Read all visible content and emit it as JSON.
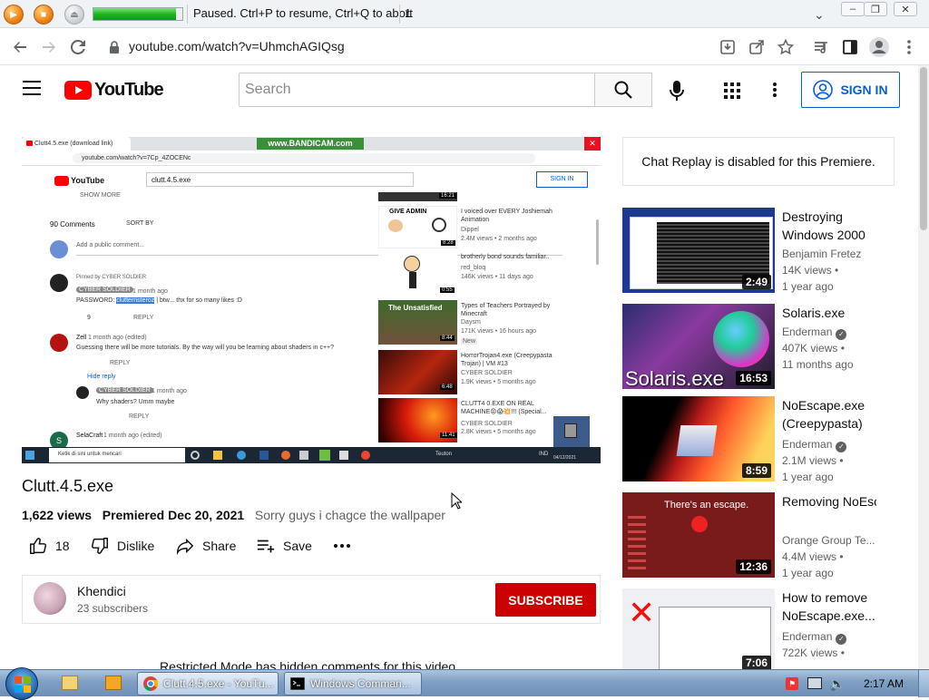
{
  "recorder": {
    "message": "Paused. Ctrl+P to resume, Ctrl+Q to abort",
    "count": "1",
    "progress": 0.93
  },
  "browser": {
    "url": "youtube.com/watch?v=UhmchAGIQsg"
  },
  "youtube": {
    "logo_text": "YouTube",
    "search_placeholder": "Search",
    "signin_label": "SIGN IN"
  },
  "video_frame": {
    "recording_watermark": "www.BANDICAM.com",
    "tab_title": "Clutt4.5.exe (download link)",
    "url": "youtube.com/watch?v=7Cp_4ZOCENc",
    "search_value": "clutt.4.5.exe",
    "signin": "SIGN IN",
    "show_more": "SHOW MORE",
    "comment_count": "90 Comments",
    "sort_by": "SORT BY",
    "add_comment": "Add a public comment...",
    "pinned": "Pinned by CYBER SOLDIER",
    "c1_author": "CYBER SOLDIER",
    "c1_time": "1 month ago",
    "c1_text_pre": "PASSWORD: ",
    "c1_text_hl": "clutternsteroz",
    "c1_text_post": " | btw... thx for so many likes :D",
    "c1_likes": "9",
    "reply": "REPLY",
    "c2_author": "Zell",
    "c2_time": "1 month ago (edited)",
    "c2_text": "Guessing there will be more tutorials. By the way will you be learning about shaders in c++?",
    "hide_reply": "Hide reply",
    "c3_author": "CYBER SOLDIER",
    "c3_time": "1 month ago",
    "c3_text": "Why shaders? Umm maybe",
    "c4_author": "SelaCraft",
    "c4_time": "1 month ago (edited)",
    "r1_duration": "16:21",
    "r2_title": "I voiced over EVERY Joshiemah Animation",
    "r2_channel": "Dippel",
    "r2_meta": "2.4M views • 2 months ago",
    "r2_duration": "8:28",
    "r2_thumb_text": "GIVE ADMIN",
    "r3_title": "brotherly bond sounds familiar..",
    "r3_channel": "red_bloq",
    "r3_meta": "146K views • 11 days ago",
    "r3_duration": "0:55",
    "r4_title": "Types of Teachers Portrayed by Minecraft",
    "r4_channel": "Daysm",
    "r4_meta": "171K views • 16 hours ago",
    "r4_badge": "New",
    "r4_duration": "8:44",
    "r4_thumb_text": "The Unsatisfied",
    "r5_title": "HorrorTrojan4.exe (Creepypasta Trojan) | VM #13",
    "r5_channel": "CYBER SOLDIER",
    "r5_meta": "1.9K views • 5 months ago",
    "r5_duration": "6:48",
    "r6_title": "CLUTT4 0.EXE ON REAL MACHINE😡😱💥!!! (Special...",
    "r6_channel": "CYBER SOLDIER",
    "r6_meta": "2.8K views • 5 months ago",
    "r6_duration": "11:41",
    "taskbar_search": "Ketik di sini untuk mencari",
    "taskbar_weather": "Teuton",
    "taskbar_lang": "IND",
    "taskbar_date": "04/12/2021"
  },
  "video": {
    "title": "Clutt.4.5.exe",
    "views": "1,622 views",
    "premiered": "Premiered Dec 20, 2021",
    "description": "Sorry guys i chagce the wallpaper",
    "likes": "18",
    "dislike_label": "Dislike",
    "share_label": "Share",
    "save_label": "Save"
  },
  "channel": {
    "name": "Khendici",
    "subscribers": "23 subscribers",
    "subscribe_label": "SUBSCRIBE"
  },
  "restricted_notice": "Restricted Mode has hidden comments for this video.",
  "chat_replay": "Chat Replay is disabled for this Premiere.",
  "related": [
    {
      "title": "Destroying Windows 2000",
      "channel": "Benjamin Fretez",
      "verified": false,
      "views": "14K views",
      "age": "1 year ago",
      "duration": "2:49"
    },
    {
      "title": "Solaris.exe",
      "channel": "Enderman",
      "verified": true,
      "views": "407K views",
      "age": "11 months ago",
      "duration": "16:53",
      "thumb_text": "Solaris.exe"
    },
    {
      "title": "NoEscape.exe (Creepypasta)",
      "channel": "Enderman",
      "verified": true,
      "views": "2.1M views",
      "age": "1 year ago",
      "duration": "8:59"
    },
    {
      "title": "Removing NoEscape.exe...",
      "channel": "Orange Group Te...",
      "verified": false,
      "views": "4.4M views",
      "age": "1 year ago",
      "duration": "12:36",
      "thumb_text": "There's an escape."
    },
    {
      "title": "How to remove NoEscape.exe...",
      "channel": "Enderman",
      "verified": true,
      "views": "722K views",
      "age": "",
      "duration": "7:06"
    }
  ],
  "taskbar": {
    "task1": "Clutt.4.5.exe - YouTu...",
    "task2": "Windows Comman...",
    "time": "2:17 AM"
  }
}
